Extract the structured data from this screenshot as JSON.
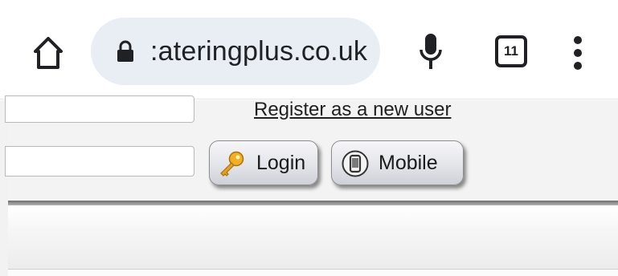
{
  "browser": {
    "url": ":ateringplus.co.uk",
    "tab_count": "11",
    "icons": {
      "home": "home-icon",
      "lock": "lock-icon",
      "mic": "microphone-icon",
      "tabs": "tab-switcher-icon",
      "menu": "more-vertical-icon"
    }
  },
  "login": {
    "register_link": "Register as a new user",
    "login_button": "Login",
    "mobile_button": "Mobile",
    "icons": {
      "login": "key-icon",
      "mobile": "mobile-phone-icon"
    }
  },
  "colors": {
    "omnibox_bg": "#e8eef4",
    "page_bg": "#f3f3f3",
    "divider": "#6e6e6e"
  }
}
